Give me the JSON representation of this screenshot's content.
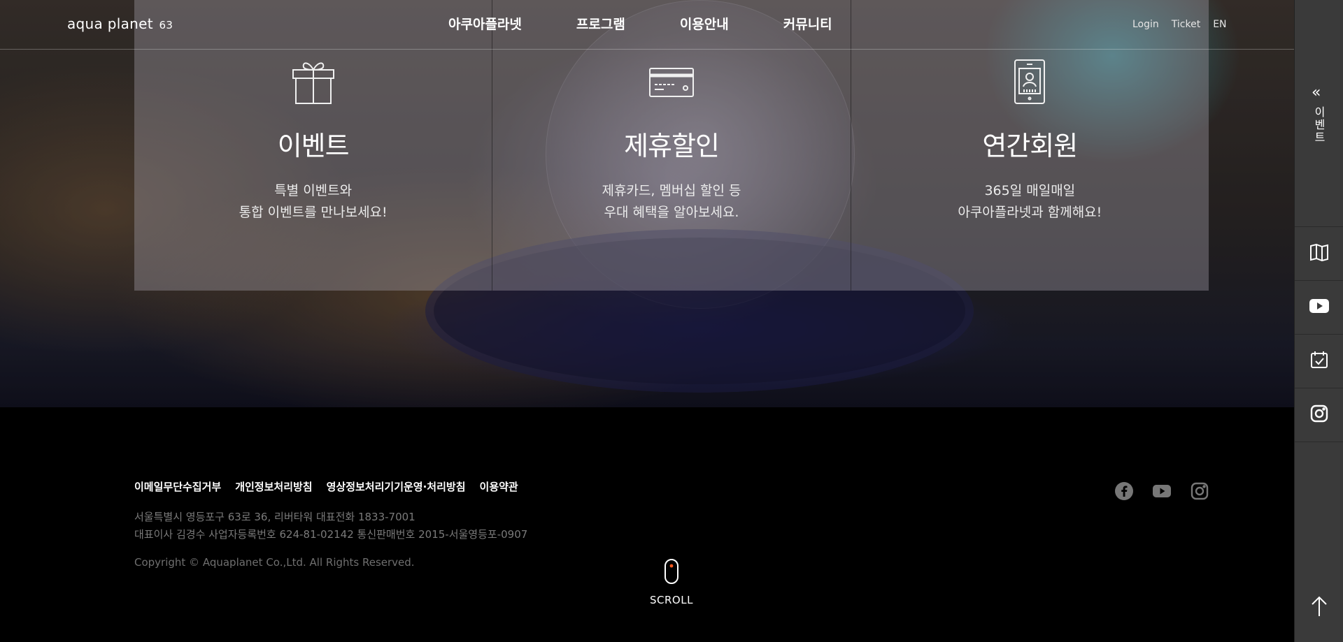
{
  "header": {
    "logo": "aqua planet",
    "logo_num": "63",
    "nav": [
      "아쿠아플라넷",
      "프로그램",
      "이용안내",
      "커뮤니티"
    ],
    "util": [
      "Login",
      "Ticket",
      "EN"
    ]
  },
  "cards": [
    {
      "icon": "gift-icon",
      "title": "이벤트",
      "line1": "특별 이벤트와",
      "line2": "통합 이벤트를 만나보세요!"
    },
    {
      "icon": "credit-card-icon",
      "title": "제휴할인",
      "line1": "제휴카드, 멤버십 할인 등",
      "line2": "우대 혜택을 알아보세요."
    },
    {
      "icon": "member-card-icon",
      "title": "연간회원",
      "line1": "365일 매일매일",
      "line2": "아쿠아플라넷과 함께해요!"
    }
  ],
  "sidebar": {
    "event_label": "이벤트",
    "chevron": "«",
    "icons": [
      "map-icon",
      "youtube-icon",
      "calendar-check-icon",
      "instagram-icon"
    ],
    "top_icon": "arrow-up-icon"
  },
  "footer": {
    "links": [
      "이메일무단수집거부",
      "개인정보처리방침",
      "영상정보처리기기운영·처리방침",
      "이용약관"
    ],
    "address": "서울특별시 영등포구 63로 36, 리버타워 대표전화 1833-7001",
    "business": "대표이사 김경수 사업자등록번호 624-81-02142 통신판매번호 2015-서울영등포-0907",
    "copyright": "Copyright © Aquaplanet Co.,Ltd. All Rights Reserved.",
    "sns": [
      "facebook-icon",
      "youtube-icon",
      "instagram-icon"
    ]
  },
  "scroll": {
    "label": "SCROLL"
  },
  "colors": {
    "accent": "#ff5a1f",
    "sidebar": "#3a3a3a",
    "footer": "#000000"
  }
}
